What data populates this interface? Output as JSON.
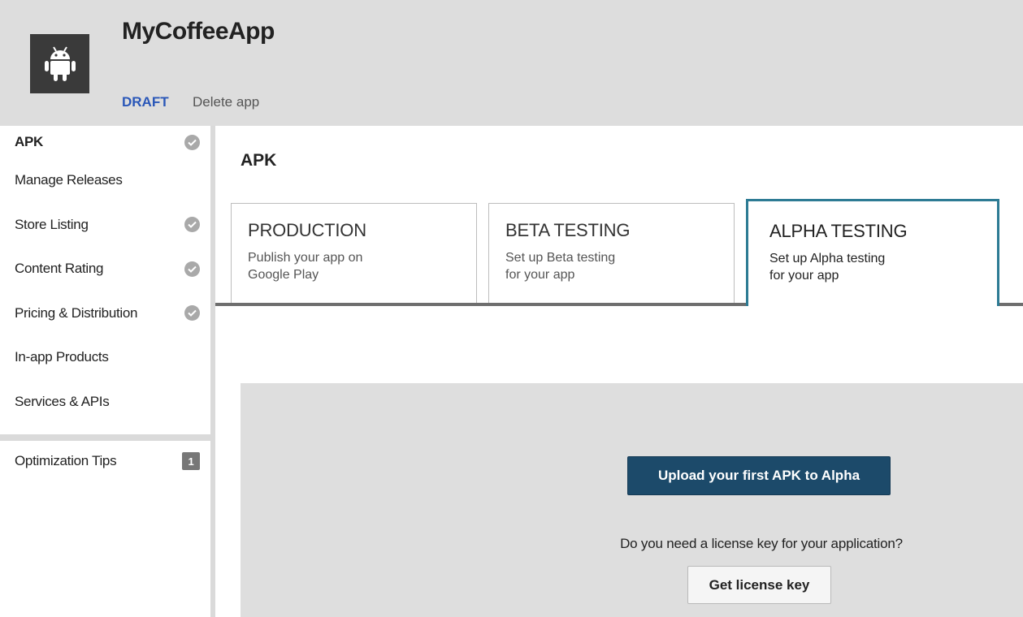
{
  "app": {
    "title": "MyCoffeeApp",
    "status": "DRAFT",
    "delete_label": "Delete app",
    "icon": "android-icon"
  },
  "sidebar": {
    "items": [
      {
        "label": "APK",
        "check": true,
        "active": true
      },
      {
        "label": "Manage Releases",
        "check": false
      },
      {
        "label": "Store Listing",
        "check": true
      },
      {
        "label": "Content Rating",
        "check": true
      },
      {
        "label": "Pricing & Distribution",
        "check": true
      },
      {
        "label": "In-app Products",
        "check": false
      },
      {
        "label": "Services & APIs",
        "check": false
      }
    ],
    "tips": {
      "label": "Optimization Tips",
      "badge": "1"
    }
  },
  "main": {
    "title": "APK",
    "tabs": [
      {
        "name": "PRODUCTION",
        "desc1": "Publish your app on",
        "desc2": "Google Play"
      },
      {
        "name": "BETA TESTING",
        "desc1": "Set up Beta testing",
        "desc2": "for your app"
      },
      {
        "name": "ALPHA TESTING",
        "desc1": "Set up Alpha testing",
        "desc2": "for your app",
        "selected": true
      }
    ],
    "upload_label": "Upload your first APK to Alpha",
    "license_question": "Do you need a license key for your application?",
    "license_button": "Get license key"
  },
  "colors": {
    "header_bg": "#dddddd",
    "status": "#2a57b8",
    "selected_tab_border": "#2d7b94",
    "primary_button": "#1c4a6a"
  }
}
